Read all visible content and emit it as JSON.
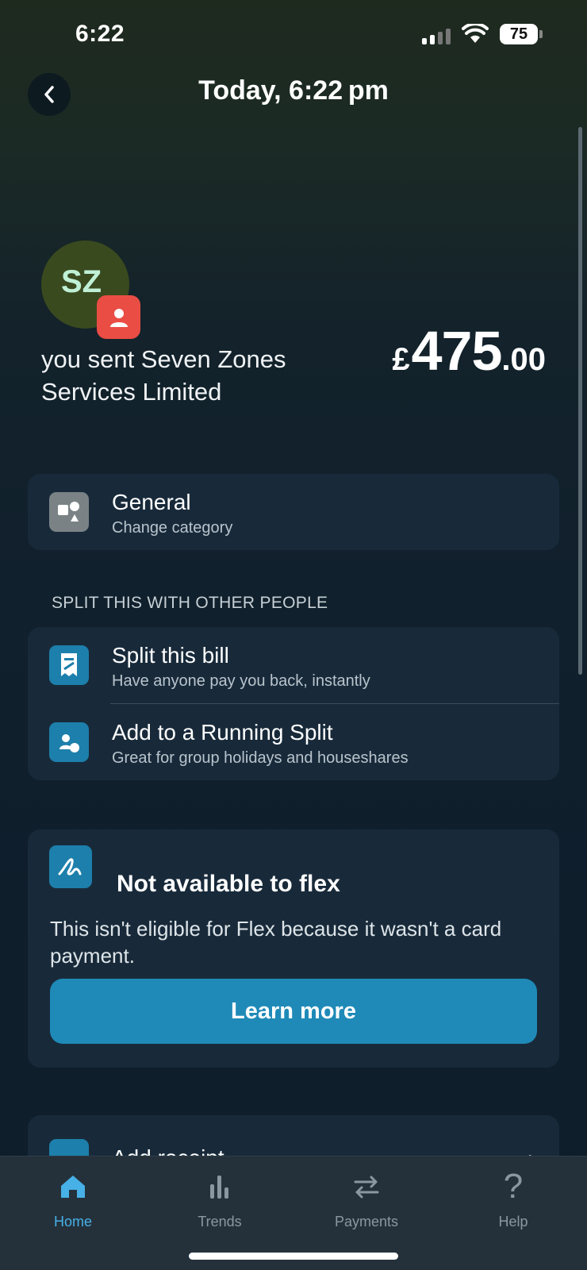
{
  "status_bar": {
    "time": "6:22",
    "battery": "75"
  },
  "header": {
    "title": "Today, 6:22 pm"
  },
  "transaction": {
    "avatar_initials": "SZ",
    "description": "you sent Seven Zones Services Limited",
    "amount_currency": "£",
    "amount_whole": "475",
    "amount_fraction": ".00"
  },
  "category": {
    "title": "General",
    "subtitle": "Change category"
  },
  "split_section": {
    "label": "SPLIT THIS WITH OTHER PEOPLE",
    "items": [
      {
        "title": "Split this bill",
        "subtitle": "Have anyone pay you back, instantly"
      },
      {
        "title": "Add to a Running Split",
        "subtitle": "Great for group holidays and houseshares"
      }
    ]
  },
  "flex": {
    "title": "Not available to flex",
    "body": "This isn't eligible for Flex because it wasn't a card payment.",
    "button": "Learn more"
  },
  "receipt": {
    "title": "Add receipt"
  },
  "tabs": [
    {
      "label": "Home",
      "icon": "home-icon",
      "active": true
    },
    {
      "label": "Trends",
      "icon": "trends-icon",
      "active": false
    },
    {
      "label": "Payments",
      "icon": "payments-icon",
      "active": false
    },
    {
      "label": "Help",
      "icon": "help-icon",
      "active": false
    }
  ],
  "colors": {
    "accent": "#1f8ab8",
    "badge": "#e94d44",
    "card": "#182a3a"
  }
}
